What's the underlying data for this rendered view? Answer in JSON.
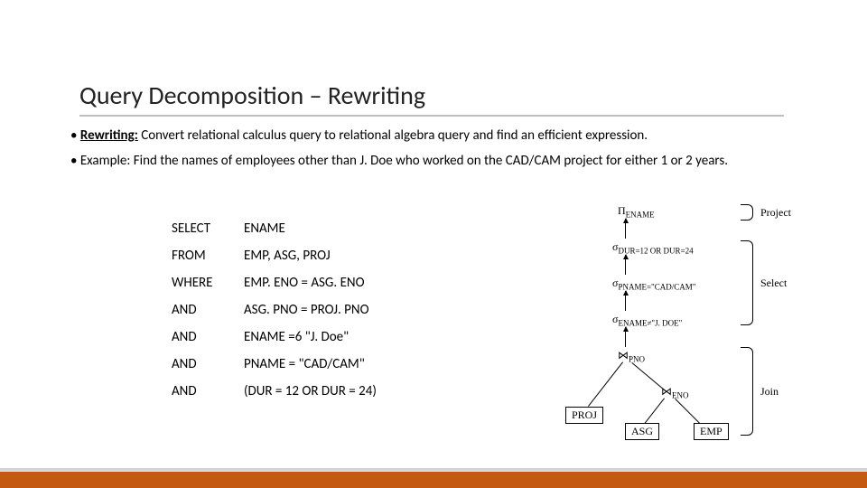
{
  "title": "Query Decomposition – Rewriting",
  "bullets": {
    "b1_prefix": "• ",
    "b1_label": "Rewriting:",
    "b1_rest": " Convert relational calculus query to relational algebra query and find an efficient expression.",
    "b2": "• Example: Find the names of employees other than J. Doe who worked on the CAD/CAM project for either 1 or 2 years."
  },
  "sql": [
    {
      "kw": "SELECT",
      "val": "ENAME"
    },
    {
      "kw": "FROM",
      "val": "EMP, ASG, PROJ"
    },
    {
      "kw": "WHERE",
      "val": "EMP. ENO = ASG. ENO"
    },
    {
      "kw": "AND",
      "val": "ASG. PNO = PROJ. PNO"
    },
    {
      "kw": "AND",
      "val": "ENAME =6 \"J. Doe\""
    },
    {
      "kw": "AND",
      "val": " PNAME = \"CAD/CAM\""
    },
    {
      "kw": "AND",
      "val": " (DUR = 12  OR  DUR = 24)"
    }
  ],
  "diagram": {
    "pi": "Π",
    "sigma": "σ",
    "join": "⋈",
    "pi_sub": "ENAME",
    "sel_sub_1": "DUR=12 OR DUR=24",
    "sel_sub_2": "PNAME=\"CAD/CAM\"",
    "sel_sub_3": "ENAME≠\"J. DOE\"",
    "join_sub_1": "PNO",
    "join_sub_2": "ENO",
    "leaf_1": "PROJ",
    "leaf_2": "ASG",
    "leaf_3": "EMP",
    "label_project": "Project",
    "label_select": "Select",
    "label_join": "Join"
  }
}
